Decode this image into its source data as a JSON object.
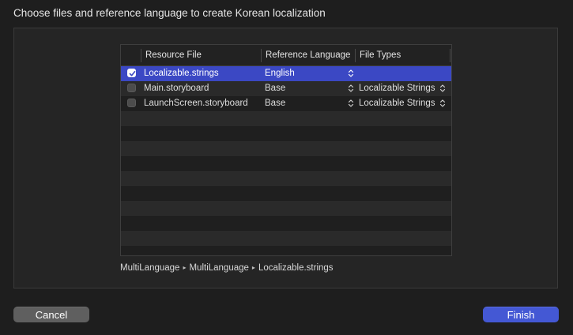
{
  "dialog": {
    "title": "Choose files and reference language to create Korean localization"
  },
  "table": {
    "columns": {
      "resource_file": "Resource File",
      "reference_language": "Reference Language",
      "file_types": "File Types"
    },
    "rows": [
      {
        "checked": true,
        "selected": true,
        "resource_file": "Localizable.strings",
        "reference_language": "English",
        "file_types": ""
      },
      {
        "checked": false,
        "selected": false,
        "resource_file": "Main.storyboard",
        "reference_language": "Base",
        "file_types": "Localizable Strings"
      },
      {
        "checked": false,
        "selected": false,
        "resource_file": "LaunchScreen.storyboard",
        "reference_language": "Base",
        "file_types": "Localizable Strings"
      }
    ],
    "empty_row_count": 10
  },
  "breadcrumb": [
    "MultiLanguage",
    "MultiLanguage",
    "Localizable.strings"
  ],
  "buttons": {
    "cancel": "Cancel",
    "finish": "Finish"
  },
  "colors": {
    "background": "#1e1e1e",
    "selection": "#3b48c4",
    "accent_button": "#4458d4",
    "secondary_button": "#5f5f5f"
  }
}
